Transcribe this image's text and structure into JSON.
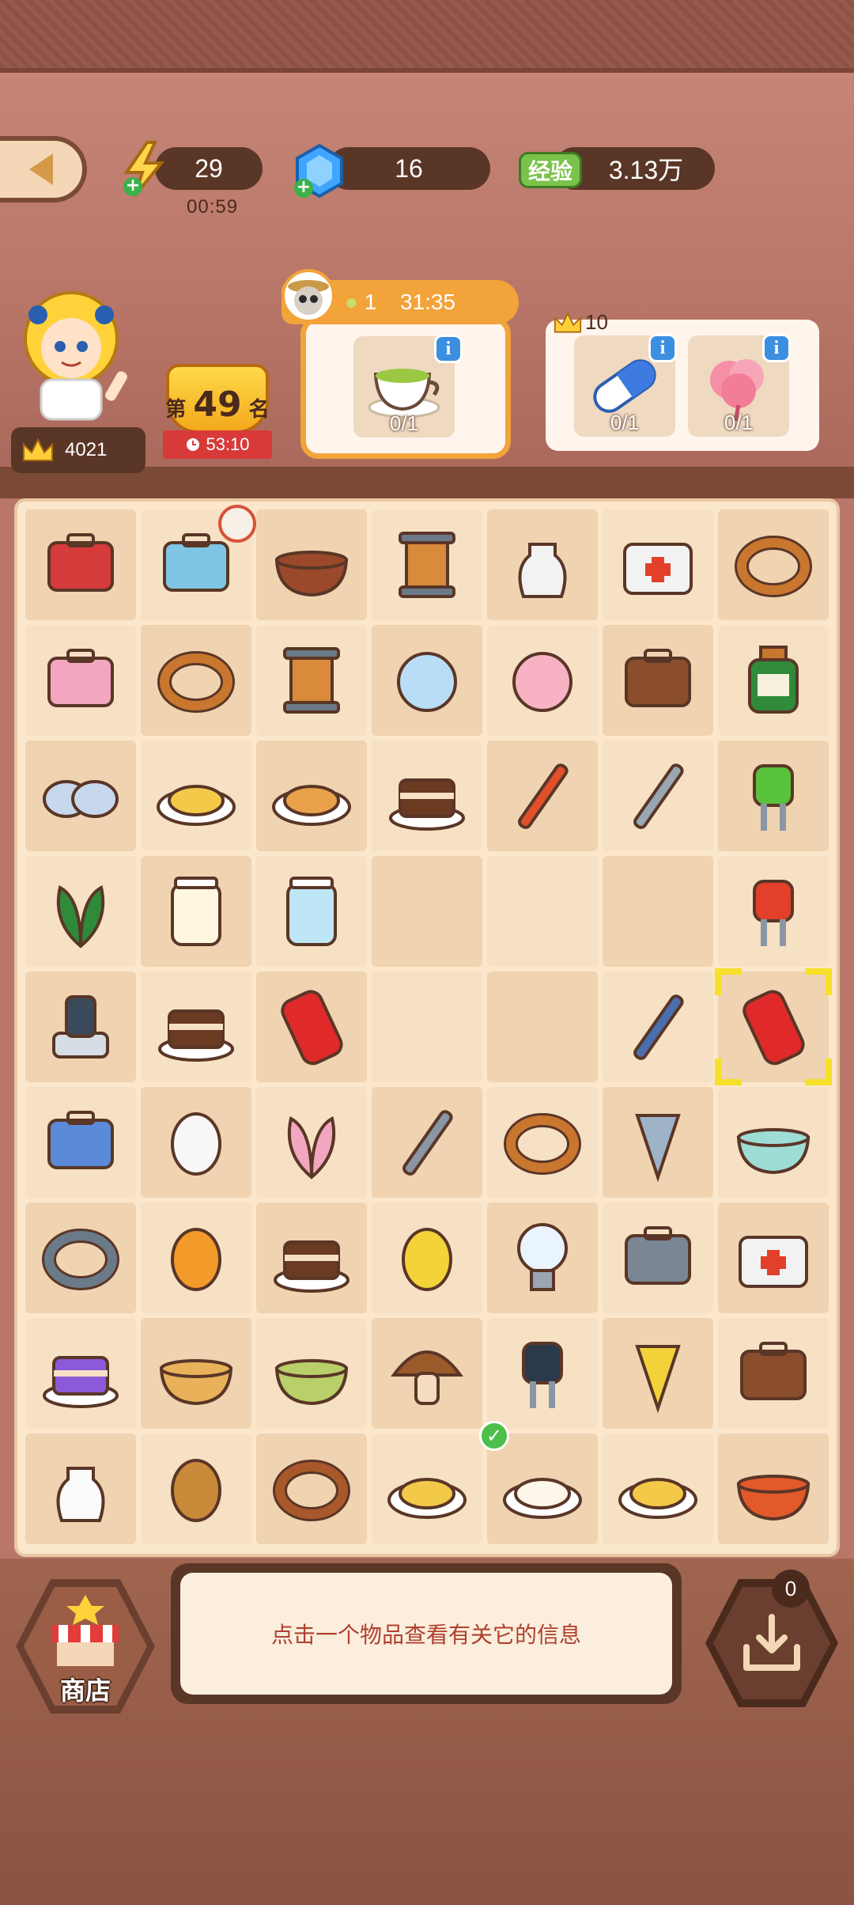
{
  "resources": {
    "energy_value": "29",
    "energy_timer": "00:59",
    "gems_value": "16",
    "exp_label": "经验",
    "exp_value": "3.13万"
  },
  "player": {
    "crown_score": "4021",
    "rank_prefix": "第",
    "rank_number": "49",
    "rank_suffix": "名",
    "rank_timer": "53:10"
  },
  "orders": {
    "main": {
      "coin_count": "1",
      "timer": "31:35",
      "items": [
        {
          "icon": "green-tea-cup-icon",
          "progress": "0/1"
        }
      ]
    },
    "side": {
      "crown_requirement": "10",
      "items": [
        {
          "icon": "capsule-pill-icon",
          "progress": "0/1"
        },
        {
          "icon": "pink-flower-bud-icon",
          "progress": "0/1"
        }
      ]
    }
  },
  "board": {
    "columns": 7,
    "rows": 9,
    "selected_cell": 34,
    "cells": [
      "toolbox-icon",
      "fridge-icon",
      "stew-pot-icon",
      "thread-spool-icon",
      "flower-vase-icon",
      "first-aid-kit-icon",
      "rope-coil-icon",
      "jewelry-box-icon",
      "pretzel-rings-icon",
      "thread-spool-icon",
      "glass-bulb-icon",
      "peach-icon",
      "gloves-icon",
      "medicine-bottle-icon",
      "pills-icon",
      "omelette-icon",
      "churro-plate-icon",
      "tiramisu-icon",
      "screwdriver-icon",
      "allen-key-icon",
      "green-led-icon",
      "spinach-icon",
      "milk-jar-icon",
      "water-glass-icon",
      "",
      "",
      "",
      "red-led-icon",
      "potentiometer-icon",
      "tiramisu-icon",
      "soda-can-icon",
      "",
      "",
      "resistor-icon",
      "soda-can-icon",
      "work-glove-icon",
      "egg-icon",
      "tulip-bouquet-icon",
      "wrench-icon",
      "dough-twist-icon",
      "drill-bit-icon",
      "soup-bowl-icon",
      "rubber-ring-icon",
      "mango-icon",
      "chocolate-cake-icon",
      "lemon-icon",
      "light-bulb-icon",
      "handle-icon",
      "emergency-light-icon",
      "rainbow-cake-icon",
      "congee-bowl-icon",
      "green-soup-icon",
      "mushroom-icon",
      "transistor-icon",
      "spring-icon",
      "gloves-icon",
      "milk-bottle-icon",
      "potatoes-icon",
      "leather-belt-icon",
      "cheesecake-icon",
      "tofu-plate-icon",
      "omelette-icon",
      "veggie-soup-icon"
    ],
    "checked_cell": 60,
    "timed_cell": 1
  },
  "bottom": {
    "shop_label": "商店",
    "info_message": "点击一个物品查看有关它的信息",
    "inventory_count": "0"
  },
  "colors": {
    "board_bg": "#fbe7cc",
    "cell": "#f0d3b0",
    "selection": "#f6e02a",
    "order_accent": "#f2a33a",
    "pill_bg": "#5a3627"
  }
}
